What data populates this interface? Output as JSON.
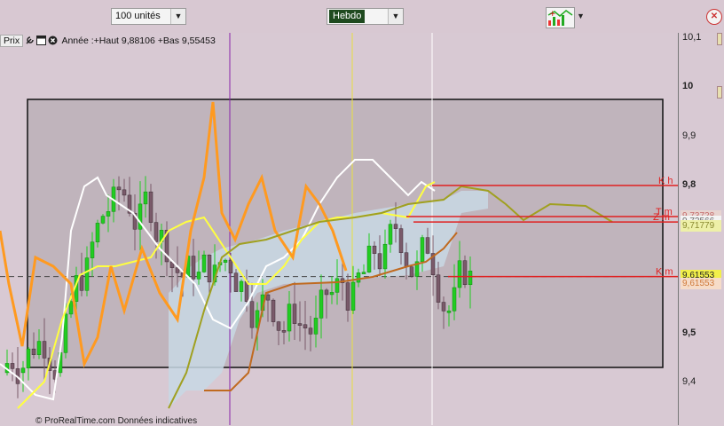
{
  "toolbar": {
    "units_value": "100 unités",
    "period_value": "Hebdo"
  },
  "legend": {
    "prix_label": "Prix",
    "text": "Année :+Haut 9,88106 +Bas 9,55453"
  },
  "axis": {
    "ticks": [
      {
        "label": "10,1",
        "value": 10.1,
        "bold": false
      },
      {
        "label": "10",
        "value": 10.0,
        "bold": true
      },
      {
        "label": "9,9",
        "value": 9.9,
        "bold": false
      },
      {
        "label": "9,8",
        "value": 9.8,
        "bold": true
      },
      {
        "label": "9,6",
        "value": 9.6,
        "bold": true
      },
      {
        "label": "9,5",
        "value": 9.5,
        "bold": true
      },
      {
        "label": "9,4",
        "value": 9.4,
        "bold": false
      }
    ],
    "price_labels": [
      {
        "label": "9,73728",
        "value": 9.7373,
        "bg": "#e8d4d0",
        "color": "#c46a6a"
      },
      {
        "label": "9,72566",
        "value": 9.7257,
        "bg": "#f4f4f4",
        "color": "#6a6a6a"
      },
      {
        "label": "9,71779",
        "value": 9.7178,
        "bg": "#eef0a8",
        "color": "#8a8a30"
      },
      {
        "label": "9,61553",
        "value": 9.6155,
        "bg": "#f2f04a",
        "color": "#222222"
      },
      {
        "label": "9,61553",
        "value": 9.6005,
        "bg": "#f6dcc8",
        "color": "#d07a3a"
      }
    ]
  },
  "lines": [
    {
      "label": "K h",
      "value": 9.8,
      "color": "#e02020"
    },
    {
      "label": "T m",
      "value": 9.737,
      "color": "#e02020"
    },
    {
      "label": "Z m",
      "value": 9.726,
      "color": "#e02020"
    },
    {
      "label": "K m",
      "value": 9.615,
      "color": "#e02020"
    }
  ],
  "colors": {
    "up_candle": "#22cc22",
    "down_candle": "#7a5a6a",
    "tenkan": "#ffffff",
    "kijun": "#ffff40",
    "chikou": "#ff9a20",
    "span_a": "#a0a020",
    "span_b": "#c06a20",
    "cloud": "#c8d8e4"
  },
  "chart_data": {
    "type": "line",
    "ylim": [
      9.37,
      10.13
    ]
  },
  "bottom_text": "© ProRealTime.com Données indicatives"
}
